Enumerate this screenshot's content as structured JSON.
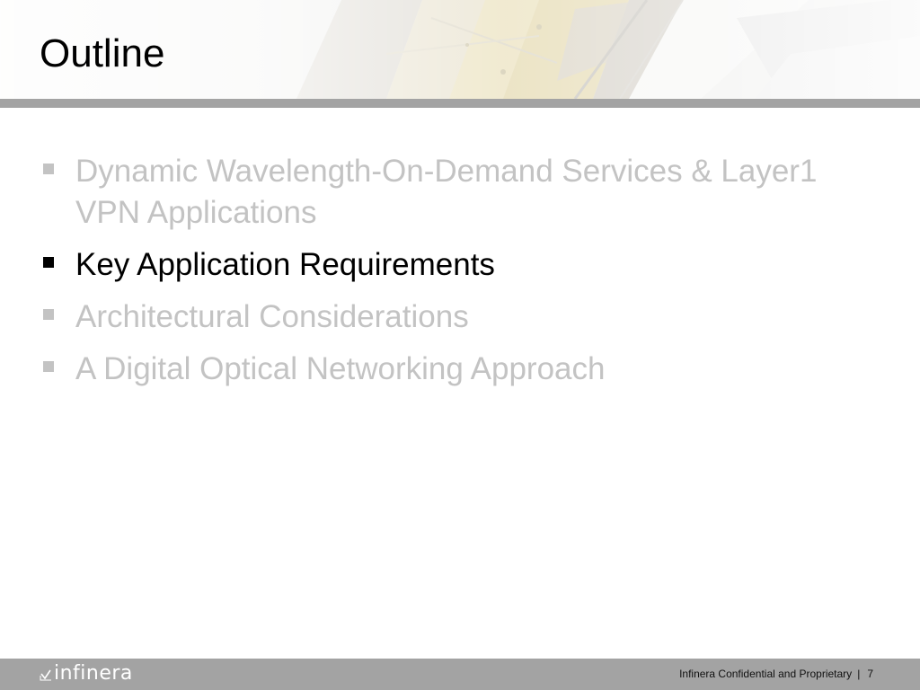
{
  "slide": {
    "title": "Outline",
    "bullets": [
      {
        "text": "Dynamic Wavelength-On-Demand Services & Layer1 VPN Applications",
        "state": "dimmed"
      },
      {
        "text": "Key Application Requirements",
        "state": "active"
      },
      {
        "text": "Architectural Considerations",
        "state": "dimmed"
      },
      {
        "text": "A Digital Optical Networking Approach",
        "state": "dimmed"
      }
    ]
  },
  "footer": {
    "logo_text": "infinera",
    "confidential_text": "Infinera Confidential and Proprietary",
    "separator": "|",
    "page_number": "7"
  },
  "colors": {
    "active_text": "#000000",
    "dimmed_text": "#c3c3c3",
    "bar_gray": "#a3a3a3",
    "logo_text": "#ffffff"
  },
  "icons": {
    "bullet": "square-bullet-icon",
    "logo": "infinera-logo-mark"
  }
}
